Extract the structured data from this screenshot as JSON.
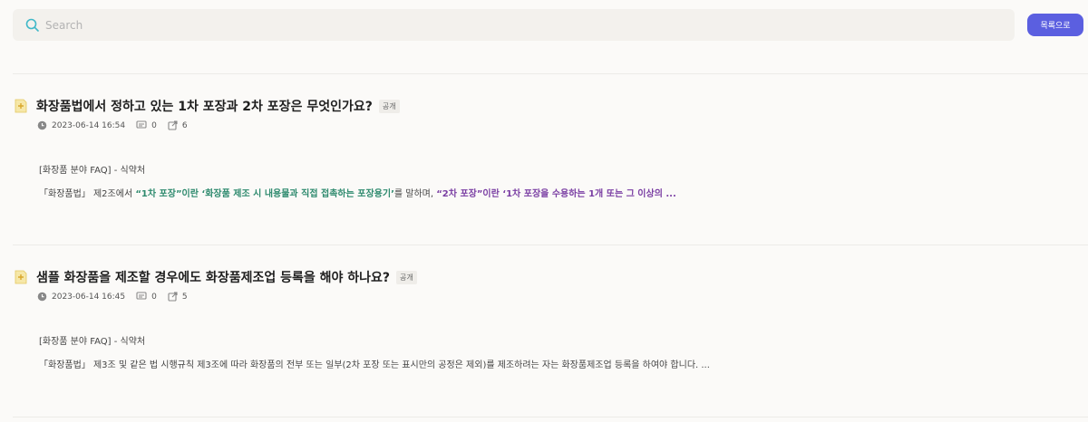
{
  "search": {
    "placeholder": "Search"
  },
  "list_button": {
    "label": "목록으로"
  },
  "posts": [
    {
      "title": "화장품법에서 정하고 있는 1차 포장과 2차 포장은 무엇인가요?",
      "badge": "공개",
      "date": "2023-06-14 16:54",
      "comments": "0",
      "shares": "6",
      "source": "[화장품 분야 FAQ] - 식약처",
      "excerpt": {
        "p1": "「화장품법」 제2조에서 ",
        "h1": "“1차 포장”이란 ‘화장품 제조 시 내용물과 직접 접촉하는 포장용기’",
        "p2": "를 말하며, ",
        "h2": "“2차 포장”이란 ‘1차 포장을 수용하는 1개 또는 그 이상의 ...",
        "p3": ""
      }
    },
    {
      "title": "샘플 화장품을 제조할 경우에도 화장품제조업 등록을 해야 하나요?",
      "badge": "공개",
      "date": "2023-06-14 16:45",
      "comments": "0",
      "shares": "5",
      "source": "[화장품 분야 FAQ] - 식약처",
      "excerpt": {
        "p1": "「화장품법」 제3조 및 같은 법 시행규칙 제3조에 따라 화장품의 전부 또는 일부(2차 포장 또는 표시만의 공정은 제외)를 제조하려는 자는 화장품제조업 등록을 하여야 합니다.  ..."
      }
    }
  ],
  "colors": {
    "accent": "#5b5fe0",
    "highlight_green": "#2e8a6e",
    "highlight_purple": "#7a3ea3"
  }
}
